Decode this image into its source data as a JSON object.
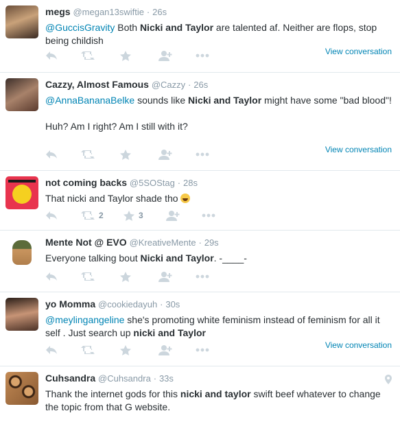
{
  "tweets": [
    {
      "name": "megs",
      "handle": "@megan13swiftie",
      "time": "26s",
      "segments": [
        {
          "type": "mention",
          "text": "@GuccisGravity"
        },
        {
          "type": "plain",
          "text": " Both "
        },
        {
          "type": "bold",
          "text": "Nicki and Taylor"
        },
        {
          "type": "plain",
          "text": " are talented af. Neither are flops, stop being childish"
        }
      ],
      "view_conversation": "View conversation",
      "retweets": "",
      "favorites": ""
    },
    {
      "name": "Cazzy, Almost Famous",
      "handle": "@Cazzy",
      "time": "26s",
      "segments": [
        {
          "type": "mention",
          "text": "@AnnaBananaBelke"
        },
        {
          "type": "plain",
          "text": " sounds like "
        },
        {
          "type": "bold",
          "text": "Nicki and Taylor"
        },
        {
          "type": "plain",
          "text": " might have some \"bad blood\"!"
        }
      ],
      "segments2": [
        {
          "type": "plain",
          "text": "Huh? Am I right? Am I still with it?"
        }
      ],
      "view_conversation": "View conversation",
      "retweets": "",
      "favorites": ""
    },
    {
      "name": "not coming backs",
      "handle": "@5SOStag",
      "time": "28s",
      "segments": [
        {
          "type": "plain",
          "text": "That nicki and Taylor shade tho "
        }
      ],
      "view_conversation": "",
      "retweets": "2",
      "favorites": "3"
    },
    {
      "name": "Mente Not @ EVO",
      "handle": "@KreativeMente",
      "time": "29s",
      "segments": [
        {
          "type": "plain",
          "text": "Everyone talking bout "
        },
        {
          "type": "bold",
          "text": "Nicki and Taylor"
        },
        {
          "type": "plain",
          "text": ". -____-"
        }
      ],
      "view_conversation": "",
      "retweets": "",
      "favorites": ""
    },
    {
      "name": "yo Momma",
      "handle": "@cookiedayuh",
      "time": "30s",
      "segments": [
        {
          "type": "mention",
          "text": "@meylingangeline"
        },
        {
          "type": "plain",
          "text": " she's promoting white feminism instead of feminism for all it self . Just search up "
        },
        {
          "type": "bold",
          "text": "nicki and Taylor"
        }
      ],
      "view_conversation": "View conversation",
      "retweets": "",
      "favorites": ""
    },
    {
      "name": "Cuhsandra",
      "handle": "@Cuhsandra",
      "time": "33s",
      "segments": [
        {
          "type": "plain",
          "text": "Thank the internet gods for this "
        },
        {
          "type": "bold",
          "text": "nicki and taylor"
        },
        {
          "type": "plain",
          "text": " swift beef whatever to change the topic from that G website."
        }
      ],
      "view_conversation": "",
      "retweets": "",
      "favorites": ""
    }
  ],
  "icons": {
    "reply": "reply-icon",
    "retweet": "retweet-icon",
    "favorite": "star-icon",
    "follow": "follow-icon",
    "more": "more-icon",
    "geo": "location-pin-icon",
    "emoji": "tears-of-joy-emoji"
  },
  "colors": {
    "link": "#0084b4",
    "muted": "#8899a6",
    "icon": "#ccd6dd",
    "text": "#292f33",
    "divider": "#e1e8ed"
  }
}
